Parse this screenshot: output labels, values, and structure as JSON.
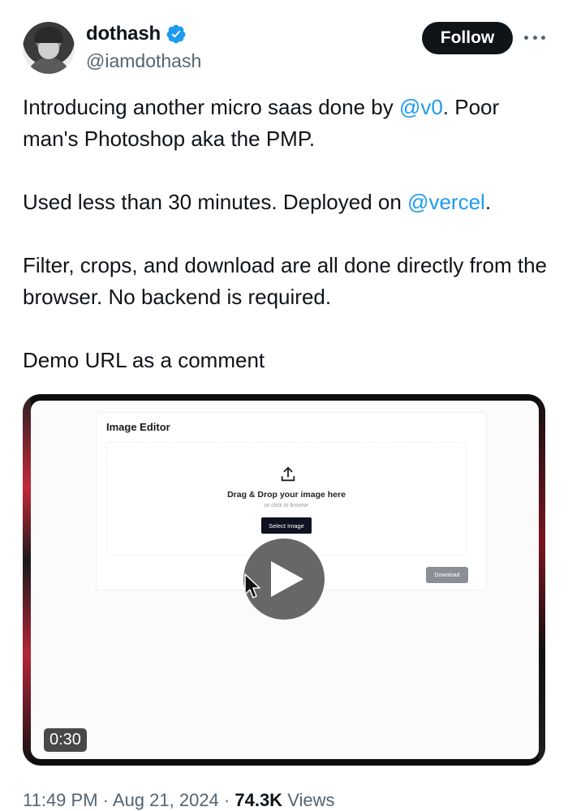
{
  "user": {
    "display_name": "dothash",
    "handle": "@iamdothash",
    "verified": true
  },
  "actions": {
    "follow_label": "Follow",
    "more_icon": "more-horizontal-icon"
  },
  "tweet": {
    "para1_a": "Introducing another micro saas done by ",
    "para1_mention": "@v0",
    "para1_b": ". Poor man's Photoshop aka the PMP.",
    "para2_a": "Used less than 30 minutes. Deployed on ",
    "para2_mention": "@vercel",
    "para2_b": ".",
    "para3": "Filter, crops, and download are all done directly from the browser. No backend is required.",
    "para4": "Demo URL as a comment"
  },
  "media": {
    "editor_title": "Image Editor",
    "drop_title": "Drag & Drop your image here",
    "drop_subtitle": "or click to browse",
    "select_button": "Select Image",
    "download_button": "Download",
    "duration": "0:30"
  },
  "meta": {
    "time": "11:49 PM",
    "separator": " · ",
    "date": "Aug 21, 2024",
    "views_count": "74.3K",
    "views_label": " Views"
  },
  "colors": {
    "mention": "#1d9bf0",
    "follow_bg": "#0f1419",
    "muted": "#536471"
  }
}
